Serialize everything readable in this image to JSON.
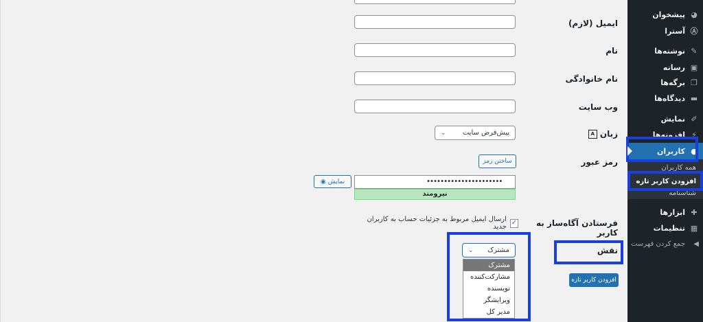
{
  "sidebar": {
    "items": [
      {
        "label": "پیشخوان",
        "icon": "dashboard-icon",
        "glyph": "◕"
      },
      {
        "label": "آسترا",
        "icon": "astra-icon",
        "glyph": "Ⓐ"
      },
      {
        "label": "نوشته‌ها",
        "icon": "pin-icon",
        "glyph": "✎"
      },
      {
        "label": "رسانه",
        "icon": "media-icon",
        "glyph": "▣"
      },
      {
        "label": "برگه‌ها",
        "icon": "pages-icon",
        "glyph": "❐"
      },
      {
        "label": "دیدگاه‌ها",
        "icon": "comments-icon",
        "glyph": "▬"
      },
      {
        "label": "نمایش",
        "icon": "appearance-icon",
        "glyph": "✐"
      },
      {
        "label": "افزونه‌ها",
        "icon": "plugins-icon",
        "glyph": "⚡"
      },
      {
        "label": "کاربران",
        "icon": "users-icon",
        "glyph": "●"
      },
      {
        "label": "ابزارها",
        "icon": "tools-icon",
        "glyph": "✚"
      },
      {
        "label": "تنظیمات",
        "icon": "settings-icon",
        "glyph": "▦"
      }
    ],
    "submenu": {
      "all_users": "همه کاربران",
      "add_new": "افزودن کاربر تازه",
      "profile": "شناسنامه"
    },
    "collapse": "جمع کردن فهرست"
  },
  "form": {
    "email_label": "ایمیل (لازم)",
    "first_name_label": "نام",
    "last_name_label": "نام خانوادگی",
    "website_label": "وب سایت",
    "language_label": "زبان",
    "language_value": "پیش‌فرض سایت",
    "password_label": "رمز عبور",
    "generate_password": "ساختن رمز",
    "password_value": "••••••••••••••••••••••",
    "show_password": "نمایش",
    "strength": "نیرومند",
    "notification_label": "فرستادن آگاه‌ساز به کاربر",
    "notification_text": "ارسال ایمیل مربوط به جزئیات حساب به کاربران جدید",
    "role_label": "نقش",
    "role_value": "مشترک",
    "role_options": [
      "مشترک",
      "مشارکت‌کننده",
      "نویسنده",
      "ویرایشگر",
      "مدیر کل"
    ],
    "submit": "افزودن کاربر تازه"
  },
  "colors": {
    "sidebar_bg": "#1d2327",
    "accent": "#2271b1",
    "highlight": "#1a3fe0",
    "strength_bg": "#b8e6bf"
  }
}
